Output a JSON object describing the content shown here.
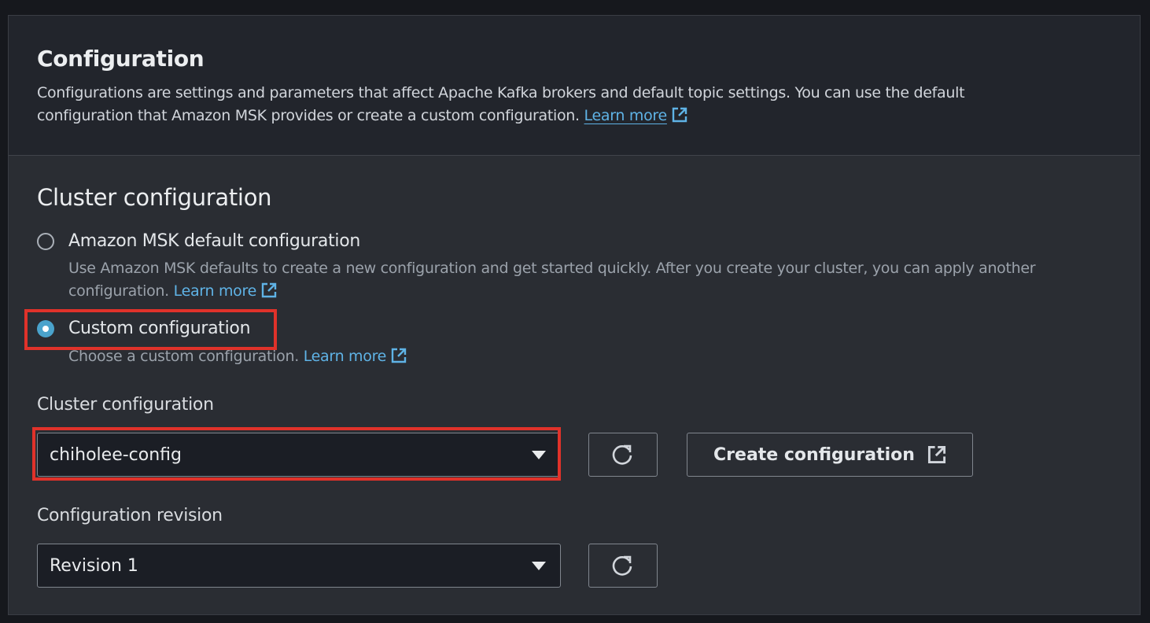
{
  "header": {
    "title": "Configuration",
    "description": "Configurations are settings and parameters that affect Apache Kafka brokers and default topic settings. You can use the default configuration that Amazon MSK provides or create a custom configuration.",
    "learn_more": "Learn more"
  },
  "cluster_config_section": {
    "heading": "Cluster configuration",
    "options": [
      {
        "label": "Amazon MSK default configuration",
        "description": "Use Amazon MSK defaults to create a new configuration and get started quickly. After you create your cluster, you can apply another configuration.",
        "learn_more": "Learn more",
        "selected": false
      },
      {
        "label": "Custom configuration",
        "description": "Choose a custom configuration.",
        "learn_more": "Learn more",
        "selected": true
      }
    ],
    "cluster_configuration_label": "Cluster configuration",
    "cluster_configuration_value": "chiholee-config",
    "create_button": "Create configuration",
    "revision_label": "Configuration revision",
    "revision_value": "Revision 1"
  },
  "colors": {
    "accent": "#4aa3cc",
    "link": "#5fb3e6",
    "highlight": "#e0322a"
  }
}
